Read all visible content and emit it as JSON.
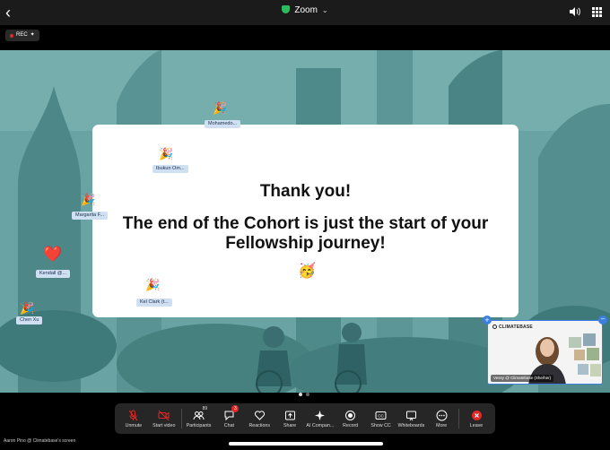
{
  "app": {
    "title": "Zoom"
  },
  "recording": {
    "label": "REC"
  },
  "slide": {
    "heading": "Thank you!",
    "subheading": "The end of the Cohort is just the start of your Fellowship journey!",
    "emoji": "🥳"
  },
  "reactions": [
    {
      "name": "Mohamedo...",
      "emoji": "🎉"
    },
    {
      "name": "Ibukun Om...",
      "emoji": "🎉"
    },
    {
      "name": "Margarita F...",
      "emoji": "🎉"
    },
    {
      "name": "Kendall @...",
      "emoji": "❤️"
    },
    {
      "name": "Kel Clark (t...",
      "emoji": "🎉"
    },
    {
      "name": "Chen Xu",
      "emoji": "🎉"
    }
  ],
  "video_thumb": {
    "logo": "CLIMATEBASE",
    "name": "Vessy @ Climatebase (She/her)"
  },
  "toolbar": {
    "unmute": "Unmute",
    "start_video": "Start video",
    "participants": "Participants",
    "participants_count": "89",
    "chat": "Chat",
    "chat_badge": "3",
    "reactions": "Reactions",
    "share": "Share",
    "ai_companion": "AI Compan...",
    "record": "Record",
    "show_cc": "Show CC",
    "whiteboards": "Whiteboards",
    "more": "More",
    "leave": "Leave"
  },
  "footer": {
    "screen_owner": "Aaron Pino @ Climatebase's screen"
  },
  "colors": {
    "accent": "#3b7fe0",
    "leave": "#e02828",
    "secure": "#2dbb5d",
    "stage": "#5f9a9b"
  }
}
